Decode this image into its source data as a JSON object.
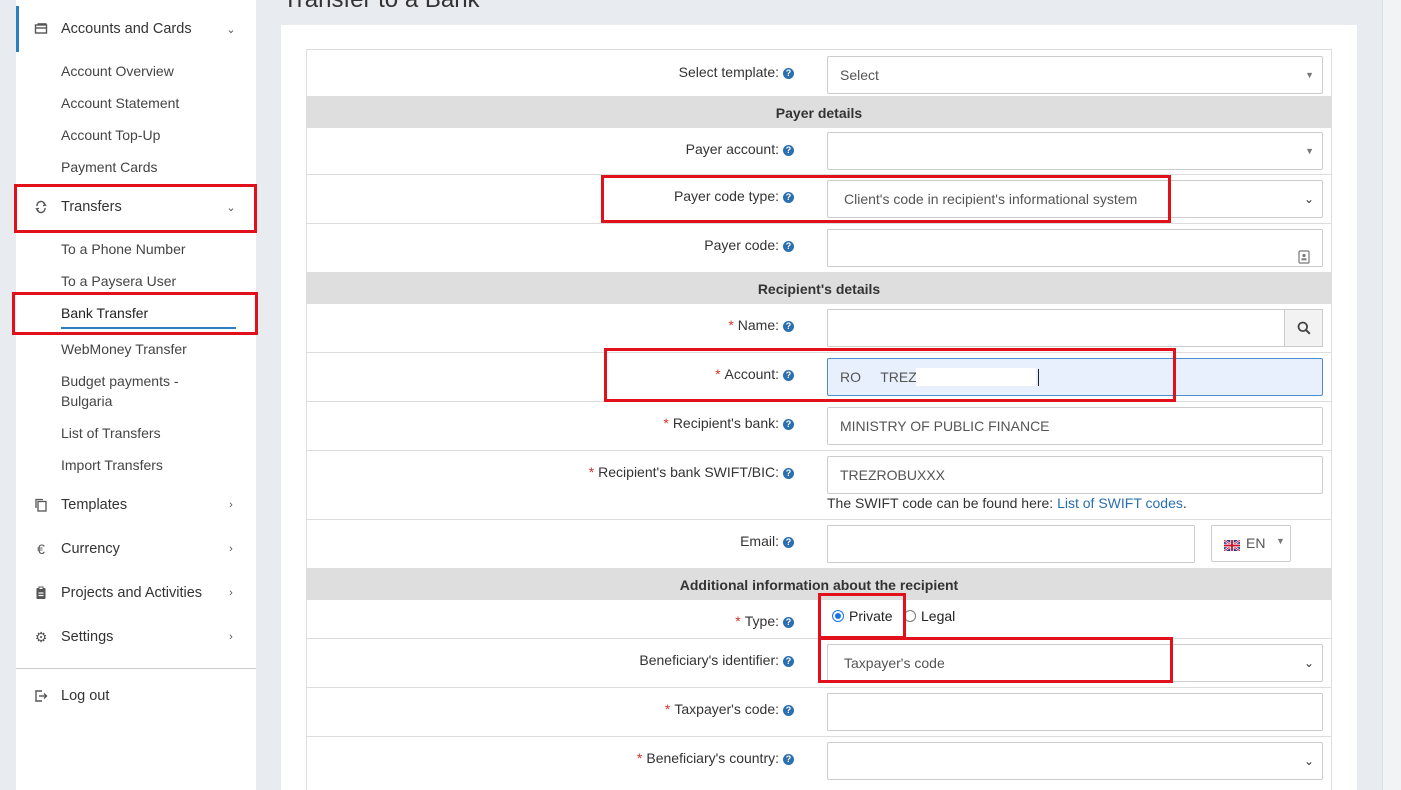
{
  "sidebar": {
    "accounts_label": "Accounts and Cards",
    "accounts_items": [
      "Account Overview",
      "Account Statement",
      "Account Top-Up",
      "Payment Cards"
    ],
    "transfers_label": "Transfers",
    "transfers_items": [
      "To a Phone Number",
      "To a Paysera User",
      "Bank Transfer",
      "WebMoney Transfer",
      "Budget payments -",
      "Bulgaria",
      "List of Transfers",
      "Import Transfers"
    ],
    "templates_label": "Templates",
    "currency_label": "Currency",
    "projects_label": "Projects and Activities",
    "settings_label": "Settings",
    "logout_label": "Log out"
  },
  "page": {
    "title": "Transfer to a Bank"
  },
  "form": {
    "select_template": {
      "label": "Select template:",
      "value": "Select"
    },
    "payer_section": "Payer details",
    "payer_account": {
      "label": "Payer account:",
      "value": ""
    },
    "payer_code_type": {
      "label": "Payer code type:",
      "value": "Client's code in recipient's informational system"
    },
    "payer_code": {
      "label": "Payer code:",
      "value": ""
    },
    "recipient_section": "Recipient's details",
    "name": {
      "label": "Name:",
      "value": ""
    },
    "account": {
      "label": "Account:",
      "value": "RO     TREZ"
    },
    "recipient_bank": {
      "label": "Recipient's bank:",
      "value": "MINISTRY OF PUBLIC FINANCE"
    },
    "swift": {
      "label": "Recipient's bank SWIFT/BIC:",
      "value": "TREZROBUXXX",
      "hint": "The SWIFT code can be found here:",
      "hint_link": "List of SWIFT codes",
      "hint_end": "."
    },
    "email": {
      "label": "Email:",
      "value": "",
      "lang": "EN"
    },
    "additional_section": "Additional information about the recipient",
    "type": {
      "label": "Type:",
      "option_private": "Private",
      "option_legal": "Legal"
    },
    "beneficiary_identifier": {
      "label": "Beneficiary's identifier:",
      "value": "Taxpayer's code"
    },
    "taxpayer_code": {
      "label": "Taxpayer's code:",
      "value": ""
    },
    "beneficiary_country": {
      "label": "Beneficiary's country:",
      "value": ""
    }
  },
  "icons": {
    "required_mark": "*",
    "help": "?"
  }
}
